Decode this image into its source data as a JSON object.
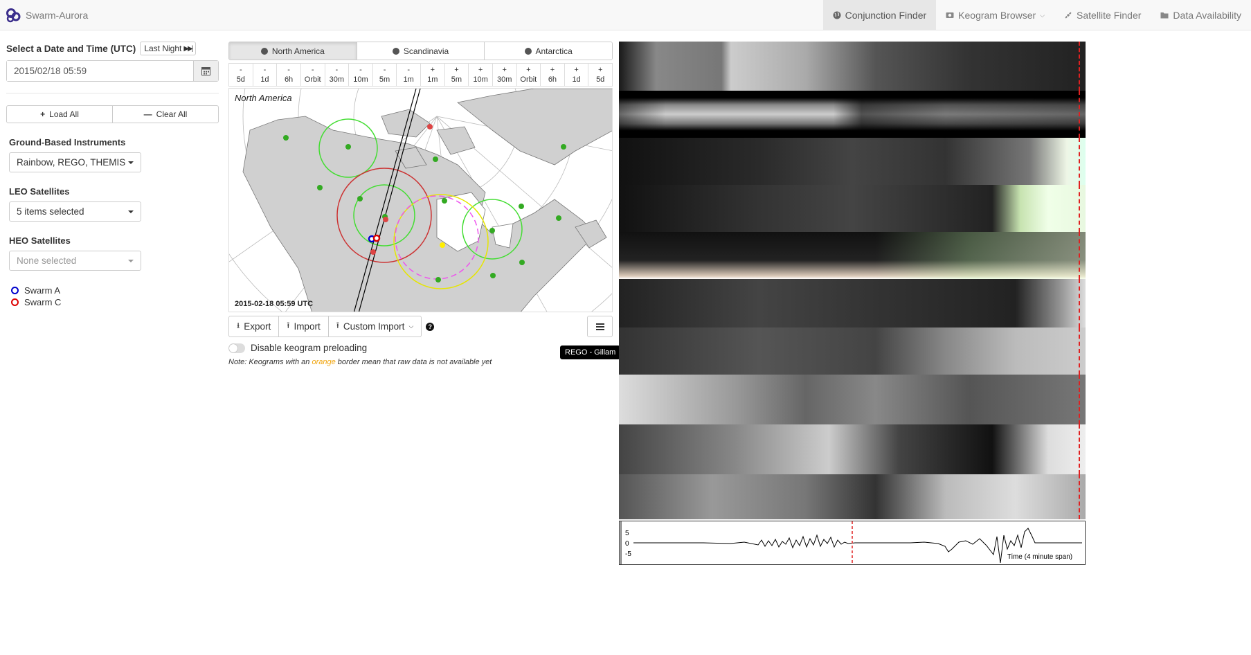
{
  "navbar": {
    "brand": "Swarm-Aurora",
    "links": [
      {
        "label": "Conjunction Finder",
        "icon": "globe-icon"
      },
      {
        "label": "Keogram Browser",
        "icon": "camera-icon"
      },
      {
        "label": "Satellite Finder",
        "icon": "satellite-icon"
      },
      {
        "label": "Data Availability",
        "icon": "folder-icon"
      }
    ]
  },
  "datetime": {
    "label": "Select a Date and Time (UTC)",
    "last_night": "Last Night",
    "value": "2015/02/18 05:59"
  },
  "buttons": {
    "load_all": "Load All",
    "clear_all": "Clear All"
  },
  "ground": {
    "label": "Ground-Based Instruments",
    "value": "Rainbow, REGO, THEMIS"
  },
  "leo": {
    "label": "LEO Satellites",
    "value": "5 items selected"
  },
  "heo": {
    "label": "HEO Satellites",
    "placeholder": "None selected"
  },
  "legend": [
    {
      "label": "Swarm A",
      "color": "#0000cc"
    },
    {
      "label": "Swarm C",
      "color": "#dd0000"
    }
  ],
  "regions": [
    "North America",
    "Scandinavia",
    "Antarctica"
  ],
  "time_steps": [
    {
      "sign": "-",
      "label": "5d"
    },
    {
      "sign": "-",
      "label": "1d"
    },
    {
      "sign": "-",
      "label": "6h"
    },
    {
      "sign": "-",
      "label": "Orbit"
    },
    {
      "sign": "-",
      "label": "30m"
    },
    {
      "sign": "-",
      "label": "10m"
    },
    {
      "sign": "-",
      "label": "5m"
    },
    {
      "sign": "-",
      "label": "1m"
    },
    {
      "sign": "+",
      "label": "1m"
    },
    {
      "sign": "+",
      "label": "5m"
    },
    {
      "sign": "+",
      "label": "10m"
    },
    {
      "sign": "+",
      "label": "30m"
    },
    {
      "sign": "+",
      "label": "Orbit"
    },
    {
      "sign": "+",
      "label": "6h"
    },
    {
      "sign": "+",
      "label": "1d"
    },
    {
      "sign": "+",
      "label": "5d"
    }
  ],
  "map": {
    "region_label": "North America",
    "timestamp": "2015-02-18 05:59 UTC"
  },
  "toolbar": {
    "export": "Export",
    "import": "Import",
    "custom_import": "Custom Import",
    "help": "?"
  },
  "preload_label": "Disable keogram preloading",
  "note": {
    "before": "Note: Keograms with an ",
    "orange": "orange",
    "after": " border mean that raw data is not available yet"
  },
  "tooltip": "REGO - Gillam",
  "mag": {
    "ticks": [
      "5",
      "0",
      "-5"
    ],
    "caption": "Time (4 minute span)"
  }
}
